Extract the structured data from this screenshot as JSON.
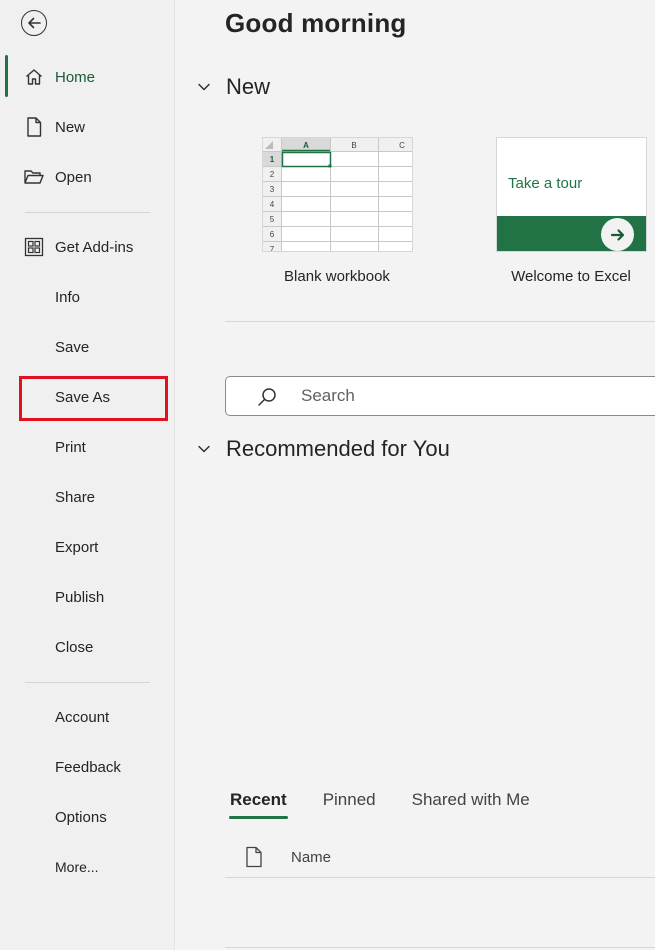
{
  "sidebar": {
    "items": [
      {
        "id": "home",
        "label": "Home",
        "icon": "home-icon"
      },
      {
        "id": "new",
        "label": "New",
        "icon": "new-file-icon"
      },
      {
        "id": "open",
        "label": "Open",
        "icon": "folder-open-icon"
      },
      {
        "id": "get-add-ins",
        "label": "Get Add-ins",
        "icon": "add-ins-grid-icon"
      },
      {
        "id": "info",
        "label": "Info"
      },
      {
        "id": "save",
        "label": "Save"
      },
      {
        "id": "save-as",
        "label": "Save As"
      },
      {
        "id": "print",
        "label": "Print"
      },
      {
        "id": "share",
        "label": "Share"
      },
      {
        "id": "export",
        "label": "Export"
      },
      {
        "id": "publish",
        "label": "Publish"
      },
      {
        "id": "close",
        "label": "Close"
      },
      {
        "id": "account",
        "label": "Account"
      },
      {
        "id": "feedback",
        "label": "Feedback"
      },
      {
        "id": "options",
        "label": "Options"
      },
      {
        "id": "more",
        "label": "More..."
      }
    ],
    "active": "home",
    "highlighted": "save-as"
  },
  "main": {
    "greeting": "Good morning",
    "new_section": {
      "title": "New",
      "templates": [
        {
          "label": "Blank workbook",
          "columns": [
            "A",
            "B",
            "C"
          ],
          "rows": [
            "1",
            "2",
            "3",
            "4",
            "5",
            "6",
            "7"
          ]
        },
        {
          "label": "Welcome to Excel",
          "caption": "Take a tour"
        }
      ]
    },
    "search": {
      "placeholder": "Search"
    },
    "recommended": {
      "title": "Recommended for You"
    },
    "files": {
      "tabs": [
        "Recent",
        "Pinned",
        "Shared with Me"
      ],
      "active_tab": "Recent",
      "columns": {
        "name": "Name"
      }
    }
  },
  "colors": {
    "accent": "#217346",
    "accent_dark": "#185c37",
    "highlight_box": "#e0121f",
    "background": "#f3f3f3"
  }
}
